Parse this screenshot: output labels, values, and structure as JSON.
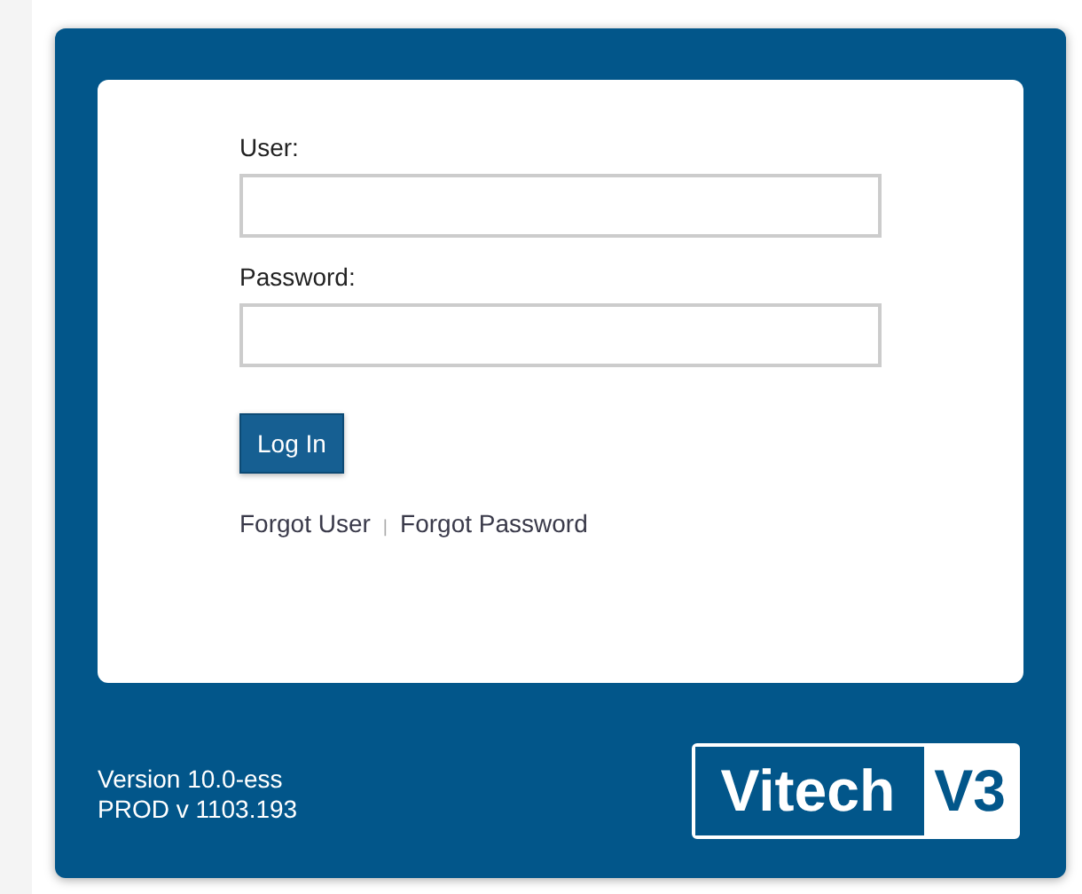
{
  "form": {
    "fields": [
      {
        "label": "User:"
      },
      {
        "label": "Password:"
      }
    ],
    "button": "Log In",
    "links": [
      "Forgot User",
      "Forgot Password"
    ],
    "link_separator": "|"
  },
  "footer": {
    "version_lines": [
      "Version 10.0-ess",
      "PROD v 1103.193"
    ],
    "logo": {
      "word": "Vitech",
      "badge": "V3"
    }
  }
}
